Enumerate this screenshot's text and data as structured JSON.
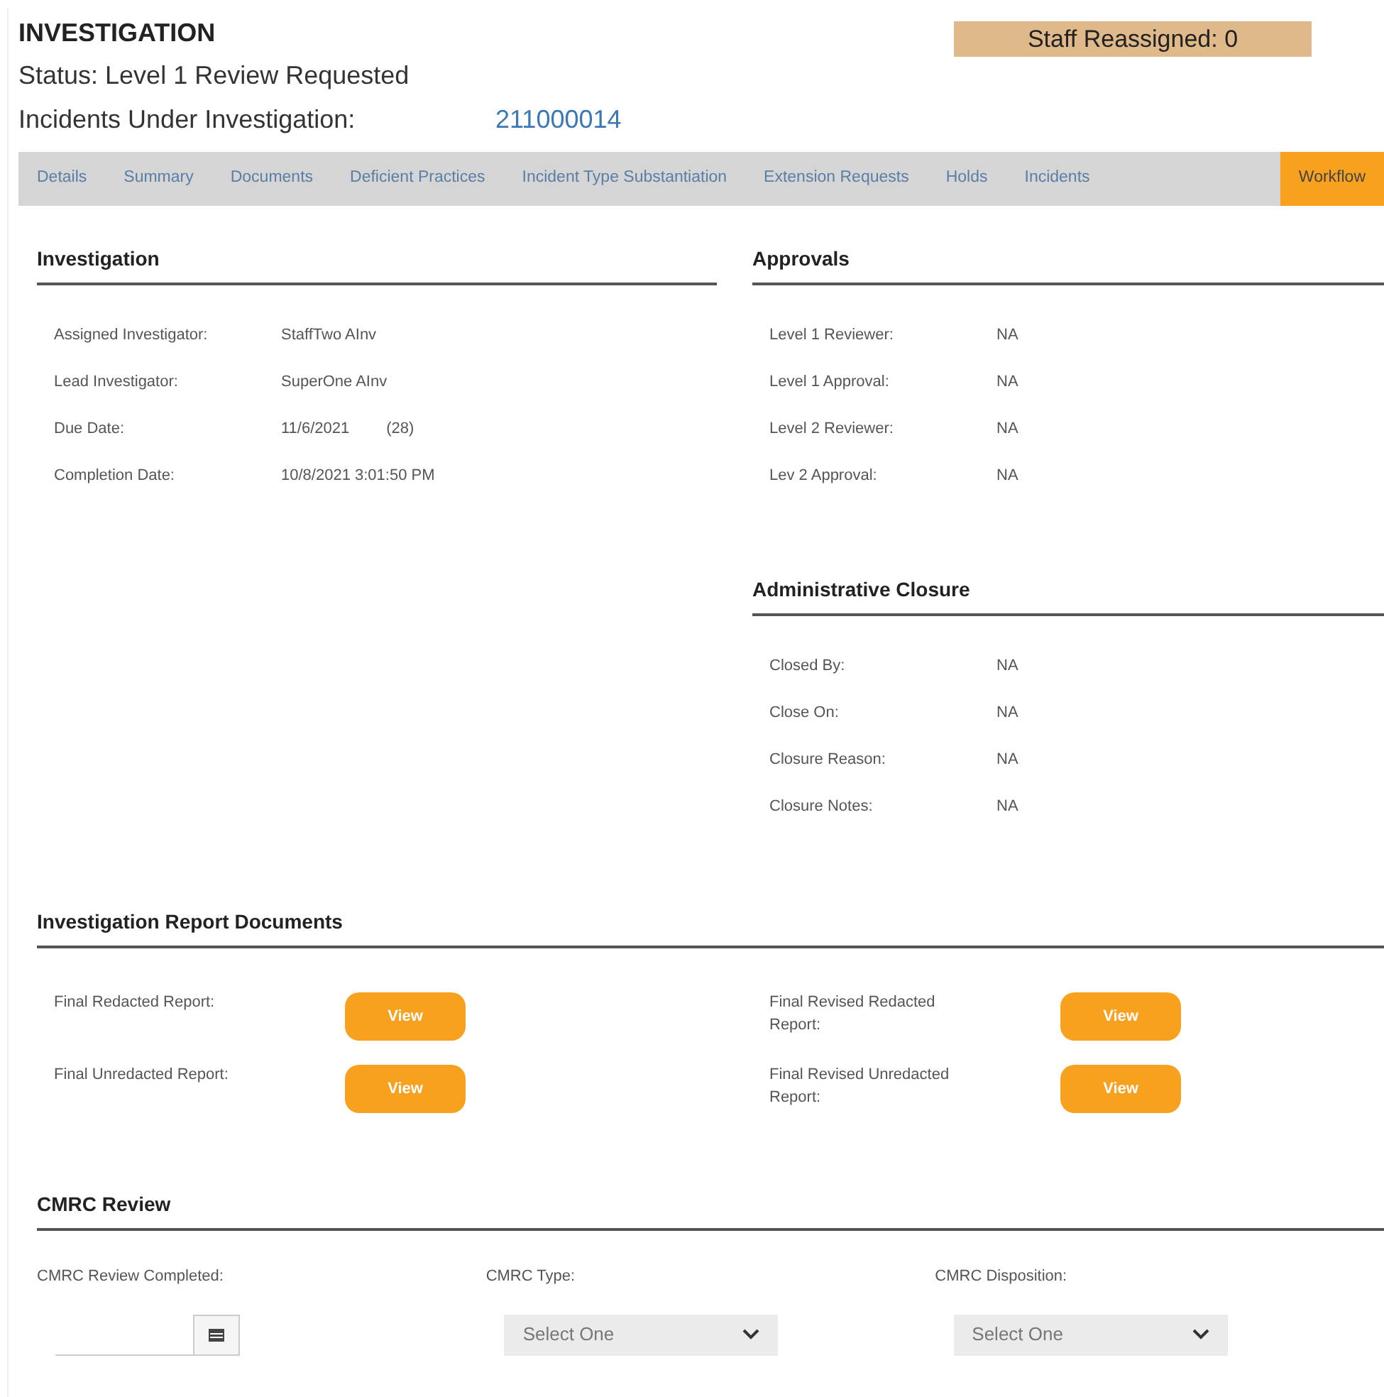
{
  "header": {
    "title": "INVESTIGATION",
    "status": "Status: Level 1 Review Requested",
    "incidents_label": "Incidents Under Investigation:",
    "incidents_link": "211000014",
    "staff_reassigned": "Staff Reassigned: 0"
  },
  "tabs": [
    {
      "label": "Details",
      "selected": false
    },
    {
      "label": "Summary",
      "selected": false
    },
    {
      "label": "Documents",
      "selected": false
    },
    {
      "label": "Deficient Practices",
      "selected": false
    },
    {
      "label": "Incident Type Substantiation",
      "selected": false
    },
    {
      "label": "Extension Requests",
      "selected": false
    },
    {
      "label": "Holds",
      "selected": false
    },
    {
      "label": "Incidents",
      "selected": false
    },
    {
      "label": "Workflow",
      "selected": true
    }
  ],
  "investigation": {
    "title": "Investigation",
    "fields": [
      {
        "label": "Assigned Investigator:",
        "value": "StaffTwo AInv"
      },
      {
        "label": "Lead Investigator:",
        "value": "SuperOne AInv"
      },
      {
        "label": "Due Date:",
        "value": "11/6/2021",
        "extra": "(28)"
      },
      {
        "label": "Completion Date:",
        "value": "10/8/2021 3:01:50 PM"
      }
    ]
  },
  "approvals": {
    "title": "Approvals",
    "fields": [
      {
        "label": "Level 1 Reviewer:",
        "value": "NA"
      },
      {
        "label": "Level 1 Approval:",
        "value": "NA"
      },
      {
        "label": "Level 2 Reviewer:",
        "value": "NA"
      },
      {
        "label": "Lev 2 Approval:",
        "value": "NA"
      }
    ]
  },
  "administrative_closure": {
    "title": "Administrative Closure",
    "fields": [
      {
        "label": "Closed By:",
        "value": "NA"
      },
      {
        "label": "Close On:",
        "value": "NA"
      },
      {
        "label": "Closure Reason:",
        "value": "NA"
      },
      {
        "label": "Closure Notes:",
        "value": "NA"
      }
    ]
  },
  "report_documents": {
    "title": "Investigation Report Documents",
    "items": [
      {
        "label": "Final Redacted Report:",
        "button": "View"
      },
      {
        "label": "Final Revised Redacted Report:",
        "button": "View"
      },
      {
        "label": "Final Unredacted Report:",
        "button": "View"
      },
      {
        "label": "Final Revised Unredacted Report:",
        "button": "View"
      }
    ]
  },
  "cmrc_review": {
    "title": "CMRC Review",
    "fields": [
      {
        "kind": "date",
        "label": "CMRC Review Completed:"
      },
      {
        "kind": "select",
        "label": "CMRC Type:",
        "value": "Select One"
      },
      {
        "kind": "select",
        "label": "CMRC Disposition:",
        "value": "Select One"
      }
    ]
  }
}
